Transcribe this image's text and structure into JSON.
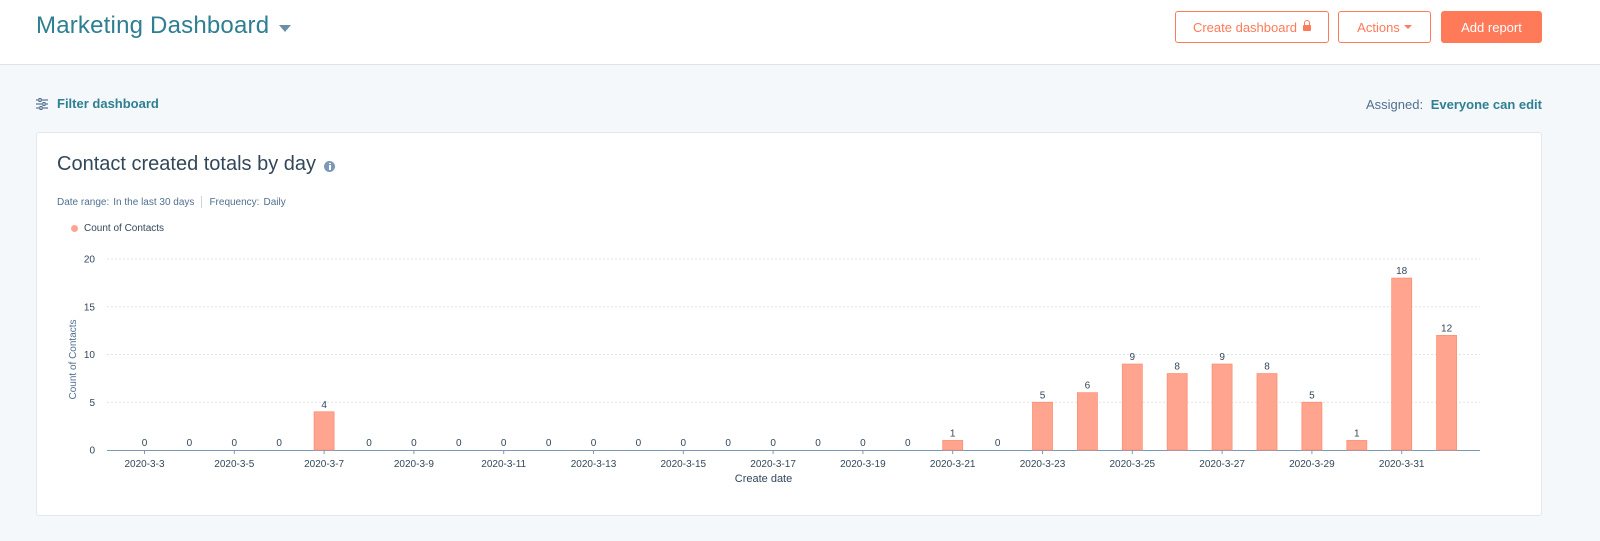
{
  "header": {
    "title": "Marketing Dashboard",
    "create_dashboard_label": "Create dashboard",
    "actions_label": "Actions",
    "add_report_label": "Add report"
  },
  "toolbar": {
    "filter_label": "Filter dashboard",
    "assigned_label": "Assigned:",
    "assigned_value": "Everyone can edit"
  },
  "report": {
    "title": "Contact created totals by day",
    "date_range_label": "Date range:",
    "date_range_value": "In the last 30 days",
    "frequency_label": "Frequency:",
    "frequency_value": "Daily"
  },
  "colors": {
    "accent": "#ff7a59",
    "bar": "#ffa58f",
    "link": "#2d7f91"
  },
  "chart_data": {
    "type": "bar",
    "categories": [
      "2020-3-3",
      "2020-3-4",
      "2020-3-5",
      "2020-3-6",
      "2020-3-7",
      "2020-3-8",
      "2020-3-9",
      "2020-3-10",
      "2020-3-11",
      "2020-3-12",
      "2020-3-13",
      "2020-3-14",
      "2020-3-15",
      "2020-3-16",
      "2020-3-17",
      "2020-3-18",
      "2020-3-19",
      "2020-3-20",
      "2020-3-21",
      "2020-3-22",
      "2020-3-23",
      "2020-3-24",
      "2020-3-25",
      "2020-3-26",
      "2020-3-27",
      "2020-3-28",
      "2020-3-29",
      "2020-3-30",
      "2020-3-31",
      "2020-4-1"
    ],
    "tick_labels": [
      "2020-3-3",
      "2020-3-5",
      "2020-3-7",
      "2020-3-9",
      "2020-3-11",
      "2020-3-13",
      "2020-3-15",
      "2020-3-17",
      "2020-3-19",
      "2020-3-21",
      "2020-3-23",
      "2020-3-25",
      "2020-3-27",
      "2020-3-29",
      "2020-3-31"
    ],
    "series": [
      {
        "name": "Count of Contacts",
        "values": [
          0,
          0,
          0,
          0,
          4,
          0,
          0,
          0,
          0,
          0,
          0,
          0,
          0,
          0,
          0,
          0,
          0,
          0,
          1,
          0,
          5,
          6,
          9,
          8,
          9,
          8,
          5,
          1,
          18,
          12
        ]
      }
    ],
    "xlabel": "Create date",
    "ylabel": "Count of Contacts",
    "ylim": [
      0,
      20
    ],
    "yticks": [
      0,
      5,
      10,
      15,
      20
    ],
    "grid": true,
    "data_labels": true
  }
}
